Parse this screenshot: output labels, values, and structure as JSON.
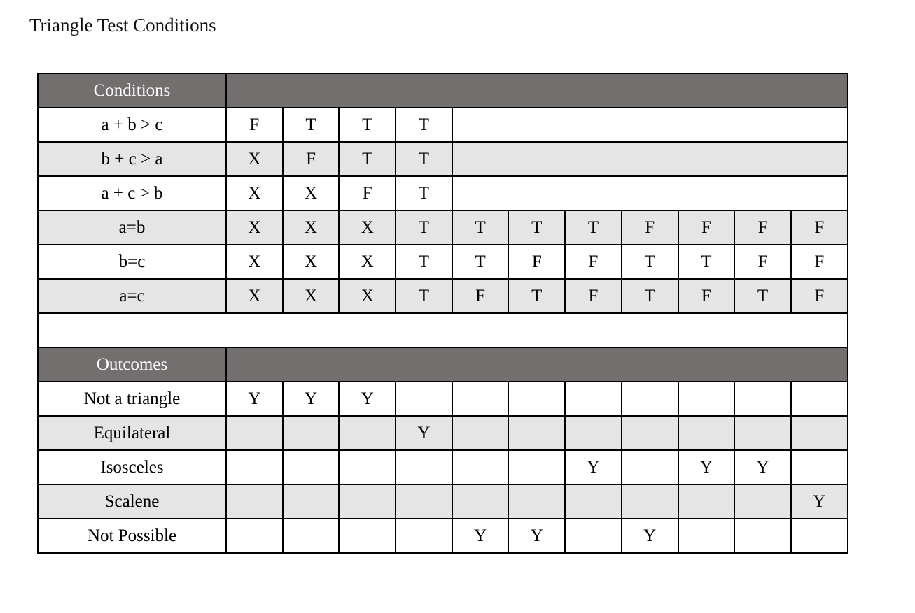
{
  "page": {
    "title": "Triangle Test Conditions",
    "background": "#ffffff"
  },
  "colors": {
    "section_header_bg": "#736f6f",
    "section_header_text": "#ffffff",
    "row_band_gray": "#e5e5e5",
    "row_band_white": "#ffffff",
    "border": "#000000",
    "text": "#000000"
  },
  "table": {
    "column_count": 11,
    "sections": [
      {
        "id": "conditions",
        "header_label": "Conditions",
        "rows": [
          {
            "label": "a + b > c",
            "band": "white",
            "values": [
              "F",
              "T",
              "T",
              "T"
            ],
            "merged_tail_from_column": 5
          },
          {
            "label": "b + c > a",
            "band": "gray",
            "values": [
              "X",
              "F",
              "T",
              "T"
            ],
            "merged_tail_from_column": 5
          },
          {
            "label": "a + c > b",
            "band": "white",
            "values": [
              "X",
              "X",
              "F",
              "T"
            ],
            "merged_tail_from_column": 5
          },
          {
            "label": "a=b",
            "band": "gray",
            "values": [
              "X",
              "X",
              "X",
              "T",
              "T",
              "T",
              "T",
              "F",
              "F",
              "F",
              "F"
            ]
          },
          {
            "label": "b=c",
            "band": "white",
            "values": [
              "X",
              "X",
              "X",
              "T",
              "T",
              "F",
              "F",
              "T",
              "T",
              "F",
              "F"
            ]
          },
          {
            "label": "a=c",
            "band": "gray",
            "values": [
              "X",
              "X",
              "X",
              "T",
              "F",
              "T",
              "F",
              "T",
              "F",
              "T",
              "F"
            ]
          }
        ]
      },
      {
        "id": "spacer",
        "header_label": "",
        "rows": []
      },
      {
        "id": "outcomes",
        "header_label": "Outcomes",
        "rows": [
          {
            "label": "Not a triangle",
            "band": "white",
            "values": [
              "Y",
              "Y",
              "Y",
              "",
              "",
              "",
              "",
              "",
              "",
              "",
              ""
            ]
          },
          {
            "label": "Equilateral",
            "band": "gray",
            "values": [
              "",
              "",
              "",
              "Y",
              "",
              "",
              "",
              "",
              "",
              "",
              ""
            ]
          },
          {
            "label": "Isosceles",
            "band": "white",
            "values": [
              "",
              "",
              "",
              "",
              "",
              "",
              "Y",
              "",
              "Y",
              "Y",
              ""
            ]
          },
          {
            "label": "Scalene",
            "band": "gray",
            "values": [
              "",
              "",
              "",
              "",
              "",
              "",
              "",
              "",
              "",
              "",
              "Y"
            ]
          },
          {
            "label": "Not Possible",
            "band": "white",
            "values": [
              "",
              "",
              "",
              "",
              "Y",
              "Y",
              "",
              "Y",
              "",
              "",
              ""
            ]
          }
        ]
      }
    ]
  }
}
